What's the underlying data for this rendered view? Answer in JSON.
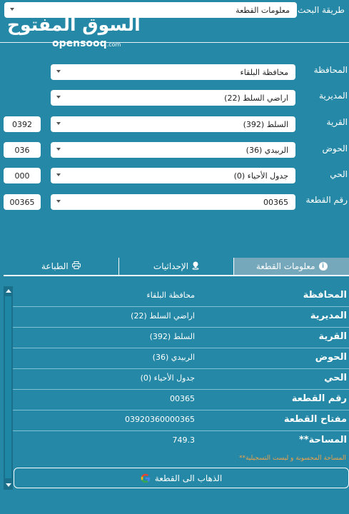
{
  "header": {
    "search_method_label": "طريقة البحث",
    "search_method_value": "معلومات القطعة",
    "logo_ar": "السوق المفتوح",
    "logo_en": "opensooq",
    "logo_en_suffix": ".com"
  },
  "form": {
    "governorate_label": "المحافظة",
    "governorate_value": "محافظة البلقاء",
    "directorate_label": "المديرية",
    "directorate_value": "اراضي السلط (22)",
    "village_label": "القرية",
    "village_value": "السلط (392)",
    "village_code": "0392",
    "basin_label": "الحوض",
    "basin_value": "الربيدي (36)",
    "basin_code": "036",
    "district_label": "الحي",
    "district_value": "جدول الأحياء (0)",
    "district_code": "000",
    "plot_label": "رقم القطعة",
    "plot_value": "00365",
    "plot_code": "00365"
  },
  "tabs": [
    {
      "label": "معلومات القطعة",
      "icon": "info-icon"
    },
    {
      "label": "الإحداثيات",
      "icon": "location-pin-icon"
    },
    {
      "label": "الطباعة",
      "icon": "printer-icon"
    }
  ],
  "results": [
    {
      "key": "المحافظة",
      "value": "محافظة البلقاء"
    },
    {
      "key": "المديرية",
      "value": "اراضي السلط (22)"
    },
    {
      "key": "القرية",
      "value": "السلط (392)"
    },
    {
      "key": "الحوض",
      "value": "الربيدي (36)"
    },
    {
      "key": "الحي",
      "value": "جدول الأحياء (0)"
    },
    {
      "key": "رقم القطعة",
      "value": "00365"
    },
    {
      "key": "مفتاح القطعة",
      "value": "03920360000365"
    },
    {
      "key": "**المساحة",
      "value": "749.3"
    }
  ],
  "note": "**المساحة المحسوبة و ليست التسجيلية",
  "goto_button": "الذهاب الى القطعة",
  "colors": {
    "background": "#2488a6",
    "active_tab": "#76a8bc",
    "note": "#f0a24a"
  }
}
